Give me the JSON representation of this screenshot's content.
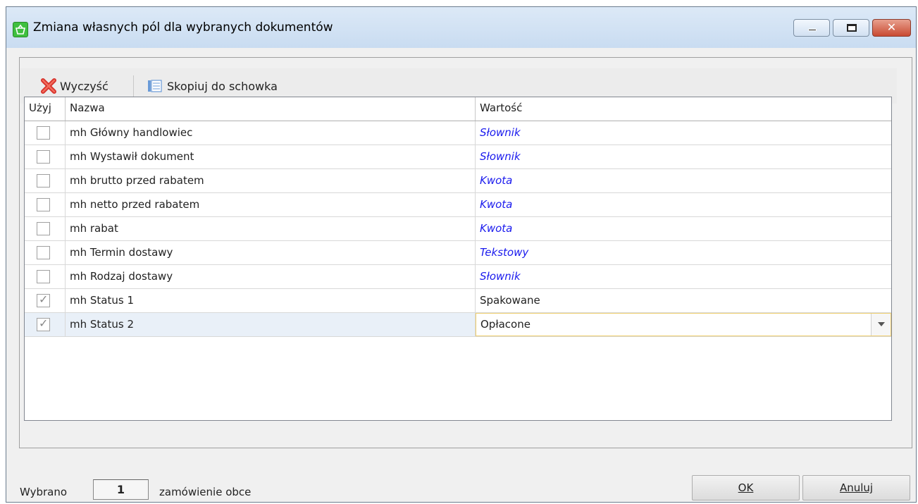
{
  "window": {
    "title": "Zmiana własnych pól dla wybranych dokumentów",
    "controls": {
      "minimize": "minimize",
      "maximize": "maximize",
      "close": "✕"
    }
  },
  "toolbar": {
    "clear_label": "Wyczyść",
    "copy_label": "Skopiuj do schowka"
  },
  "grid": {
    "columns": {
      "use": "Użyj",
      "name": "Nazwa",
      "value": "Wartość"
    },
    "rows": [
      {
        "checked": false,
        "name": "mh Główny handlowiec",
        "value": "Słownik",
        "is_type": true
      },
      {
        "checked": false,
        "name": "mh Wystawił dokument",
        "value": "Słownik",
        "is_type": true
      },
      {
        "checked": false,
        "name": "mh brutto przed rabatem",
        "value": "Kwota",
        "is_type": true
      },
      {
        "checked": false,
        "name": "mh netto przed rabatem",
        "value": "Kwota",
        "is_type": true
      },
      {
        "checked": false,
        "name": "mh rabat",
        "value": "Kwota",
        "is_type": true
      },
      {
        "checked": false,
        "name": "mh Termin dostawy",
        "value": "Tekstowy",
        "is_type": true
      },
      {
        "checked": false,
        "name": "mh Rodzaj dostawy",
        "value": "Słownik",
        "is_type": true
      },
      {
        "checked": true,
        "name": "mh Status 1",
        "value": "Spakowane",
        "is_type": false
      },
      {
        "checked": true,
        "name": "mh Status 2",
        "value": "Opłacone",
        "is_type": false,
        "selected": true,
        "editing": true
      }
    ]
  },
  "footer": {
    "selected_prefix": "Wybrano",
    "selected_count": "1",
    "selected_suffix": "zamówienie obce",
    "ok_label": "OK",
    "cancel_label": "Anuluj"
  },
  "colors": {
    "type_text": "#1a1aee",
    "title_bg": "#c9dcf1",
    "close_button": "#c94a32",
    "selected_row": "#e9f0f8"
  }
}
